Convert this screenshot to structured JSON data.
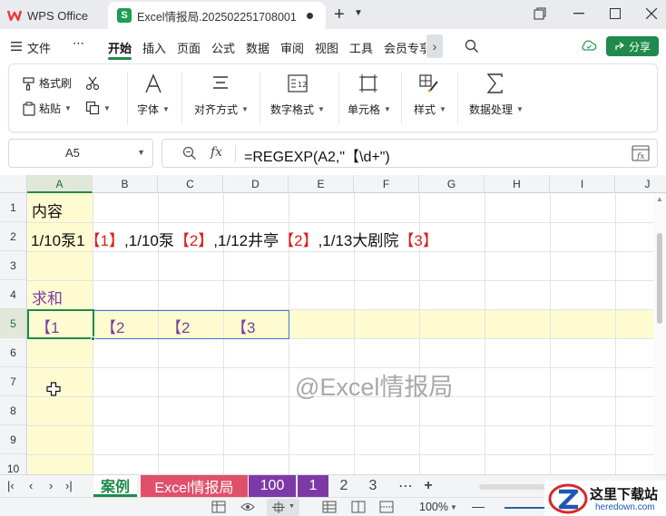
{
  "titlebar": {
    "app_name": "WPS Office",
    "doc_tab_label": "Excel情报局.202502251708001",
    "doc_icon_letter": "S",
    "new_tab": "+"
  },
  "menubar": {
    "file": "文件",
    "more": "⋯",
    "items": [
      "开始",
      "插入",
      "页面",
      "公式",
      "数据",
      "审阅",
      "视图",
      "工具",
      "会员专享"
    ],
    "active": "开始",
    "share": "分享"
  },
  "ribbon": {
    "format_painter": "格式刷",
    "paste": "粘贴",
    "font": "字体",
    "align": "对齐方式",
    "number_format": "数字格式",
    "cells": "单元格",
    "styles": "样式",
    "data_processing": "数据处理"
  },
  "formula_bar": {
    "name_box": "A5",
    "fx": "fx",
    "formula": "=REGEXP(A2,\"【\\d+\")"
  },
  "grid": {
    "columns": [
      "A",
      "B",
      "C",
      "D",
      "E",
      "F",
      "G",
      "H",
      "I",
      "J"
    ],
    "rows": [
      "1",
      "2",
      "3",
      "4",
      "5",
      "6",
      "7",
      "8",
      "9",
      "10"
    ],
    "selected_column": "A",
    "selected_row": "5",
    "a1": "内容",
    "a2_parts": [
      {
        "text": "1/10泵1",
        "color": "black"
      },
      {
        "text": "【1】",
        "color": "red"
      },
      {
        "text": ",1/10泵",
        "color": "black"
      },
      {
        "text": "【2】",
        "color": "red"
      },
      {
        "text": ",1/12井亭",
        "color": "black"
      },
      {
        "text": "【2】",
        "color": "red"
      },
      {
        "text": ",1/13大剧院",
        "color": "black"
      },
      {
        "text": "【3】",
        "color": "red"
      }
    ],
    "a4": "求和",
    "row5": [
      "【1",
      "【2",
      "【2",
      "【3"
    ],
    "watermark": "@Excel情报局"
  },
  "sheet_tabs": {
    "tabs": [
      "案例",
      "Excel情报局",
      "100",
      "1",
      "2",
      "3"
    ],
    "more": "⋯",
    "add": "+"
  },
  "statusbar": {
    "zoom": "100%",
    "zoom_minus": "—"
  },
  "site_logo": {
    "name": "这里下载站",
    "url": "heredown.com"
  },
  "colors": {
    "accent_green": "#1f8a4c",
    "highlight_yellow": "#fefbd1",
    "red_text": "#d9211e",
    "purple_text": "#7c3fa3",
    "pink_tab": "#e0506b",
    "purple_tab": "#7d3aa6"
  }
}
